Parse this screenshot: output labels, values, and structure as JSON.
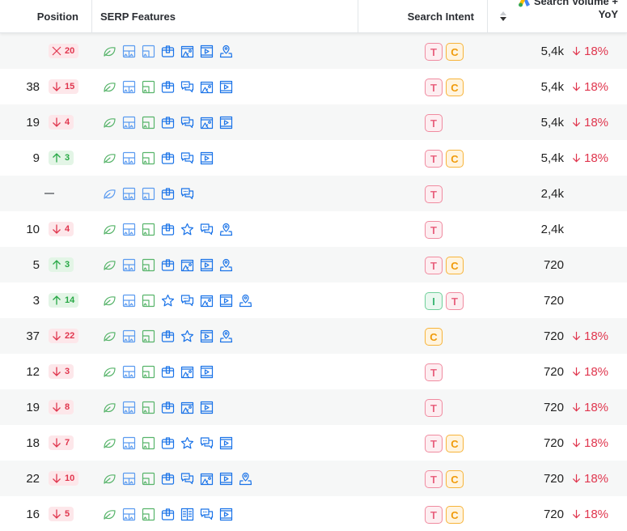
{
  "header": {
    "position": "Position",
    "serp_features": "SERP Features",
    "search_intent": "Search Intent",
    "volume_line1": "Search Volume +",
    "volume_line2": "YoY",
    "volume_icon": "google-ads-icon",
    "sort_icon": "sort-descending-icon"
  },
  "colors": {
    "down": "#e0364e",
    "up": "#27a845",
    "feature_blue": "#1a73e8",
    "feature_green": "#4caf50",
    "intent_T": "#e96480",
    "intent_C": "#f09b0b",
    "intent_I": "#3bb673"
  },
  "rows": [
    {
      "position": "",
      "delta": {
        "dir": "lost",
        "value": "20"
      },
      "features": [
        "leaf-g",
        "images-b",
        "image-b",
        "box",
        "gallery",
        "video",
        "pin"
      ],
      "intent": [
        "T",
        "C"
      ],
      "volume": "5,4k",
      "yoy": "18%"
    },
    {
      "position": "38",
      "delta": {
        "dir": "down",
        "value": "15"
      },
      "features": [
        "leaf-g",
        "images-b",
        "image-g",
        "box",
        "chat",
        "gallery",
        "video"
      ],
      "intent": [
        "T",
        "C"
      ],
      "volume": "5,4k",
      "yoy": "18%"
    },
    {
      "position": "19",
      "delta": {
        "dir": "down",
        "value": "4"
      },
      "features": [
        "leaf-g",
        "images-b",
        "image-g",
        "box",
        "chat",
        "gallery",
        "video"
      ],
      "intent": [
        "T"
      ],
      "volume": "5,4k",
      "yoy": "18%"
    },
    {
      "position": "9",
      "delta": {
        "dir": "up",
        "value": "3"
      },
      "features": [
        "leaf-g",
        "images-b",
        "image-g",
        "box",
        "chat",
        "video"
      ],
      "intent": [
        "T",
        "C"
      ],
      "volume": "5,4k",
      "yoy": "18%"
    },
    {
      "position": "—",
      "delta": null,
      "features": [
        "leaf-b",
        "images-b",
        "image-b",
        "box",
        "chat"
      ],
      "intent": [
        "T"
      ],
      "volume": "2,4k",
      "yoy": ""
    },
    {
      "position": "10",
      "delta": {
        "dir": "down",
        "value": "4"
      },
      "features": [
        "leaf-g",
        "images-b",
        "image-g",
        "box",
        "star",
        "chat",
        "pin"
      ],
      "intent": [
        "T"
      ],
      "volume": "2,4k",
      "yoy": ""
    },
    {
      "position": "5",
      "delta": {
        "dir": "up",
        "value": "3"
      },
      "features": [
        "leaf-g",
        "images-b",
        "image-g",
        "box",
        "gallery",
        "video",
        "pin"
      ],
      "intent": [
        "T",
        "C"
      ],
      "volume": "720",
      "yoy": ""
    },
    {
      "position": "3",
      "delta": {
        "dir": "up",
        "value": "14"
      },
      "features": [
        "leaf-g",
        "images-b",
        "image-g",
        "star",
        "chat",
        "gallery",
        "video",
        "pin"
      ],
      "intent": [
        "I",
        "T"
      ],
      "volume": "720",
      "yoy": ""
    },
    {
      "position": "37",
      "delta": {
        "dir": "down",
        "value": "22"
      },
      "features": [
        "leaf-g",
        "images-b",
        "image-g",
        "box",
        "star",
        "video",
        "pin"
      ],
      "intent": [
        "C"
      ],
      "volume": "720",
      "yoy": "18%"
    },
    {
      "position": "12",
      "delta": {
        "dir": "down",
        "value": "3"
      },
      "features": [
        "leaf-g",
        "images-b",
        "image-g",
        "box",
        "gallery",
        "video"
      ],
      "intent": [
        "T"
      ],
      "volume": "720",
      "yoy": "18%"
    },
    {
      "position": "19",
      "delta": {
        "dir": "down",
        "value": "8"
      },
      "features": [
        "leaf-g",
        "images-b",
        "image-g",
        "box",
        "gallery",
        "video"
      ],
      "intent": [
        "T"
      ],
      "volume": "720",
      "yoy": "18%"
    },
    {
      "position": "18",
      "delta": {
        "dir": "down",
        "value": "7"
      },
      "features": [
        "leaf-g",
        "images-b",
        "image-g",
        "box",
        "star",
        "chat",
        "video"
      ],
      "intent": [
        "T",
        "C"
      ],
      "volume": "720",
      "yoy": "18%"
    },
    {
      "position": "22",
      "delta": {
        "dir": "down",
        "value": "10"
      },
      "features": [
        "leaf-g",
        "images-b",
        "image-g",
        "box",
        "chat",
        "gallery",
        "video",
        "pin"
      ],
      "intent": [
        "T",
        "C"
      ],
      "volume": "720",
      "yoy": "18%"
    },
    {
      "position": "16",
      "delta": {
        "dir": "down",
        "value": "5"
      },
      "features": [
        "leaf-g",
        "images-b",
        "image-g",
        "box",
        "book",
        "chat",
        "video"
      ],
      "intent": [
        "T",
        "C"
      ],
      "volume": "720",
      "yoy": "18%"
    }
  ]
}
